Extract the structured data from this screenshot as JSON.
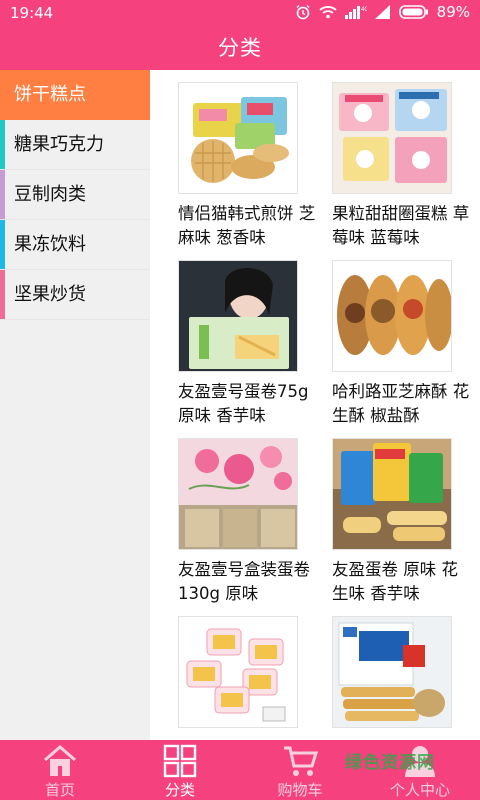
{
  "status_bar": {
    "time": "19:44",
    "battery": "89%",
    "network": "4G"
  },
  "title": "分类",
  "categories": [
    {
      "label": "饼干糕点",
      "active": true,
      "accent": "#ff7f43"
    },
    {
      "label": "糖果巧克力",
      "active": false,
      "accent": "#22c7c7"
    },
    {
      "label": "豆制肉类",
      "active": false,
      "accent": "#c79ad8"
    },
    {
      "label": "果冻饮料",
      "active": false,
      "accent": "#20b8e6"
    },
    {
      "label": "坚果炒货",
      "active": false,
      "accent": "#f06a9a"
    }
  ],
  "products": [
    {
      "name": "情侣猫韩式煎饼 芝麻味 葱香味",
      "image_icon": "cookie-pack-image"
    },
    {
      "name": "果粒甜甜圈蛋糕 草莓味 蓝莓味",
      "image_icon": "donut-pack-image"
    },
    {
      "name": "友盈壹号蛋卷75g 原味 香芋味",
      "image_icon": "egg-roll-ad-image"
    },
    {
      "name": "哈利路亚芝麻酥 花生酥 椒盐酥",
      "image_icon": "sesame-cake-image"
    },
    {
      "name": "友盈壹号盒装蛋卷130g 原味",
      "image_icon": "egg-roll-box-image"
    },
    {
      "name": "友盈蛋卷 原味 花生味 香芋味",
      "image_icon": "egg-roll-bags-image"
    },
    {
      "name": "",
      "image_icon": "cake-packs-image"
    },
    {
      "name": "",
      "image_icon": "biscuit-sticks-image"
    }
  ],
  "tabs": [
    {
      "label": "首页",
      "icon": "home-icon"
    },
    {
      "label": "分类",
      "icon": "category-grid-icon"
    },
    {
      "label": "购物车",
      "icon": "cart-icon"
    },
    {
      "label": "个人中心",
      "icon": "person-icon"
    }
  ],
  "watermark": "绿色资源网",
  "colors": {
    "brand": "#f5417e",
    "active_category": "#ff7f43",
    "sidebar_bg": "#f0f0f0"
  }
}
